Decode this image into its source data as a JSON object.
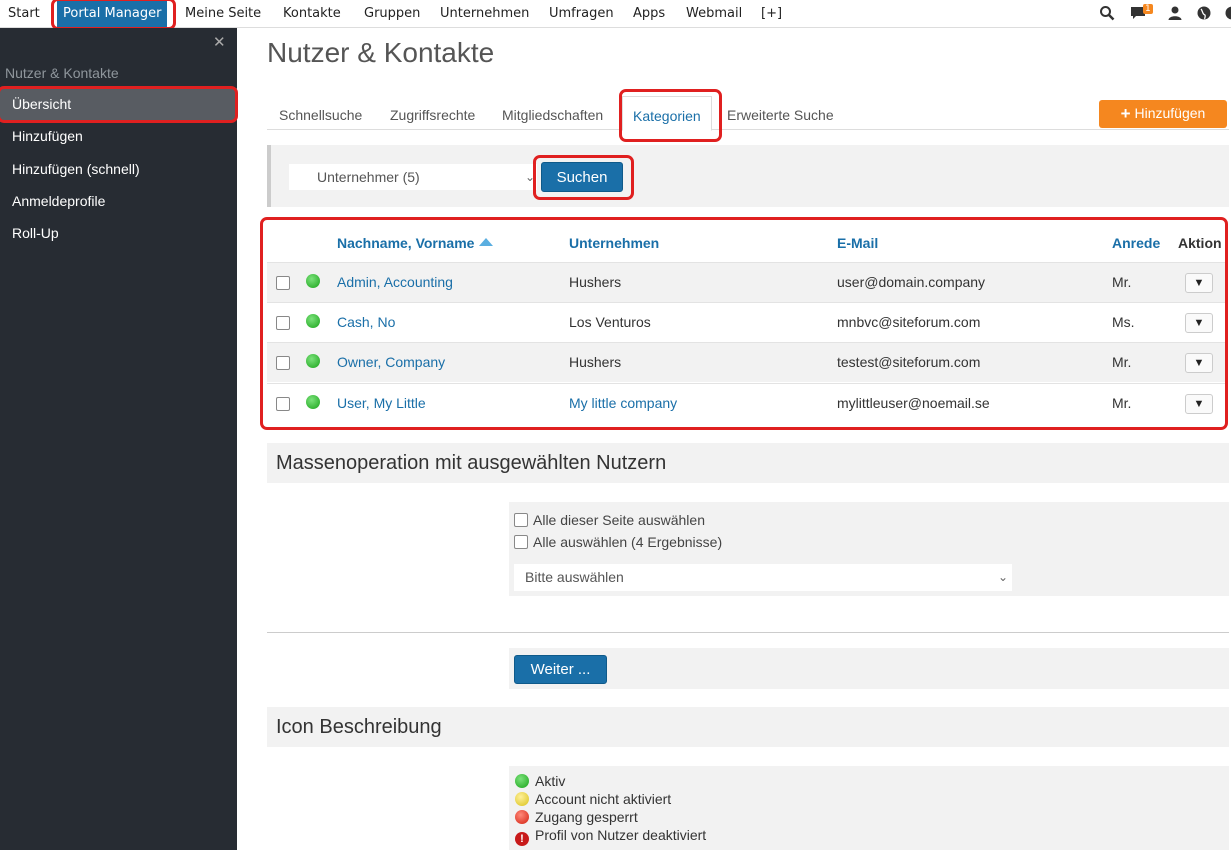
{
  "topnav": {
    "items": [
      "Start",
      "Portal Manager",
      "Meine Seite",
      "Kontakte",
      "Gruppen",
      "Unternehmen",
      "Umfragen",
      "Apps",
      "Webmail",
      "[+]"
    ],
    "notification_count": "1"
  },
  "sidebar": {
    "section_title": "Nutzer & Kontakte",
    "items": [
      "Übersicht",
      "Hinzufügen",
      "Hinzufügen (schnell)",
      "Anmeldeprofile",
      "Roll-Up"
    ]
  },
  "page_title": "Nutzer & Kontakte",
  "tabs": [
    "Schnellsuche",
    "Zugriffsrechte",
    "Mitgliedschaften",
    "Kategorien",
    "Erweiterte Suche"
  ],
  "add_button": "Hinzufügen",
  "filter": {
    "selected": "Unternehmer (5)",
    "search_button": "Suchen"
  },
  "table": {
    "columns": [
      "Nachname, Vorname",
      "Unternehmen",
      "E-Mail",
      "Anrede",
      "Aktion"
    ],
    "rows": [
      {
        "name": "Admin, Accounting",
        "company": "Hushers",
        "email": "user@domain.company",
        "salutation": "Mr."
      },
      {
        "name": "Cash, No",
        "company": "Los Venturos",
        "email": "mnbvc@siteforum.com",
        "salutation": "Ms."
      },
      {
        "name": "Owner, Company",
        "company": "Hushers",
        "email": "testest@siteforum.com",
        "salutation": "Mr."
      },
      {
        "name": "User, My Little",
        "company": "My little company",
        "email": "mylittleuser@noemail.se",
        "salutation": "Mr."
      }
    ]
  },
  "mass": {
    "title": "Massenoperation mit ausgewählten Nutzern",
    "select_page": "Alle dieser Seite auswählen",
    "select_all": "Alle auswählen (4 Ergebnisse)",
    "dropdown": "Bitte auswählen",
    "next_button": "Weiter ..."
  },
  "legend": {
    "title": "Icon Beschreibung",
    "items": [
      "Aktiv",
      "Account nicht aktiviert",
      "Zugang gesperrt",
      "Profil von Nutzer deaktiviert"
    ]
  },
  "colors": {
    "accent": "#1a6fa8",
    "orange": "#f5871f",
    "highlight": "#e02020",
    "sidebar_bg": "#272c33"
  }
}
